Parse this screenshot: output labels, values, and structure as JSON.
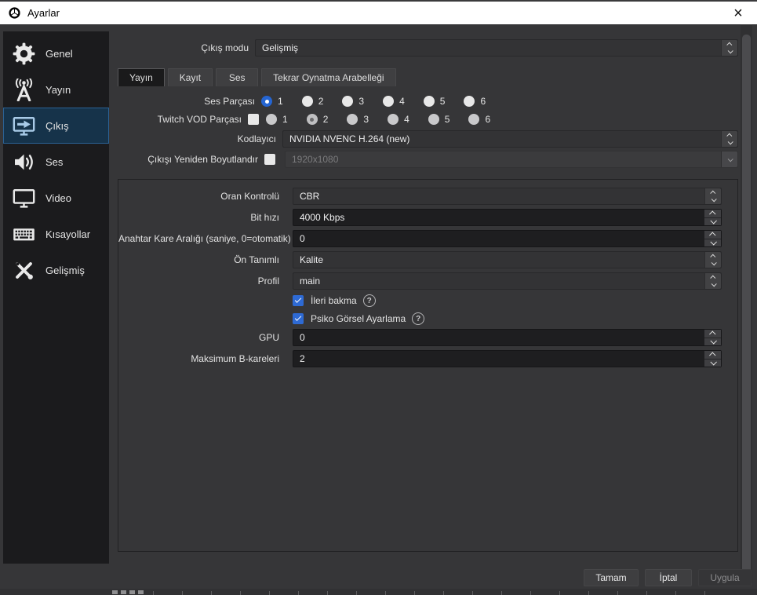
{
  "window": {
    "title": "Ayarlar",
    "close_icon": "×"
  },
  "colors": {
    "titlebar_bg": "#ffffff",
    "dialog_bg": "#363638",
    "sidebar_bg": "#1b1b1d",
    "selected_nav_bg": "#16334a",
    "selected_nav_border": "#2b6295",
    "accent_blue": "#2e6ad4",
    "field_dark": "#1e1e20",
    "combo_bg": "#333335"
  },
  "sidebar": {
    "selected": "Çıkış",
    "items": [
      {
        "label": "Genel",
        "icon": "gear-icon"
      },
      {
        "label": "Yayın",
        "icon": "broadcast-icon"
      },
      {
        "label": "Çıkış",
        "icon": "display-arrow-icon"
      },
      {
        "label": "Ses",
        "icon": "speaker-icon"
      },
      {
        "label": "Video",
        "icon": "display-icon"
      },
      {
        "label": "Kısayollar",
        "icon": "keyboard-icon"
      },
      {
        "label": "Gelişmiş",
        "icon": "tools-icon"
      }
    ]
  },
  "output_mode": {
    "label": "Çıkış modu",
    "value": "Gelişmiş"
  },
  "tabs": [
    {
      "label": "Yayın",
      "active": true
    },
    {
      "label": "Kayıt",
      "active": false
    },
    {
      "label": "Ses",
      "active": false
    },
    {
      "label": "Tekrar Oynatma Arabelleği",
      "active": false
    }
  ],
  "streaming": {
    "audio_track": {
      "label": "Ses Parçası",
      "selected": "1",
      "options": [
        "1",
        "2",
        "3",
        "4",
        "5",
        "6"
      ]
    },
    "twitch_vod": {
      "label": "Twitch VOD Parçası",
      "enabled_checkbox": false,
      "selected": "2",
      "disabled": true,
      "options": [
        "1",
        "2",
        "3",
        "4",
        "5",
        "6"
      ]
    },
    "encoder": {
      "label": "Kodlayıcı",
      "value": "NVIDIA NVENC H.264 (new)"
    },
    "rescale": {
      "label": "Çıkışı Yeniden Boyutlandır",
      "checked": false,
      "value": "1920x1080",
      "disabled": true
    },
    "encoder_settings": {
      "rate_control": {
        "label": "Oran Kontrolü",
        "value": "CBR"
      },
      "bitrate": {
        "label": "Bit hızı",
        "value": "4000 Kbps"
      },
      "keyframe_interval": {
        "label": "Anahtar Kare Aralığı (saniye, 0=otomatik)",
        "value": "0"
      },
      "preset": {
        "label": "Ön Tanımlı",
        "value": "Kalite"
      },
      "profile": {
        "label": "Profil",
        "value": "main"
      },
      "lookahead": {
        "label": "İleri bakma",
        "checked": true,
        "help_icon": "?"
      },
      "psycho_visual": {
        "label": "Psiko Görsel Ayarlama",
        "checked": true,
        "help_icon": "?"
      },
      "gpu": {
        "label": "GPU",
        "value": "0"
      },
      "max_bframes": {
        "label": "Maksimum B-kareleri",
        "value": "2"
      }
    }
  },
  "footer": {
    "ok": "Tamam",
    "cancel": "İptal",
    "apply": "Uygula",
    "apply_disabled": true
  }
}
